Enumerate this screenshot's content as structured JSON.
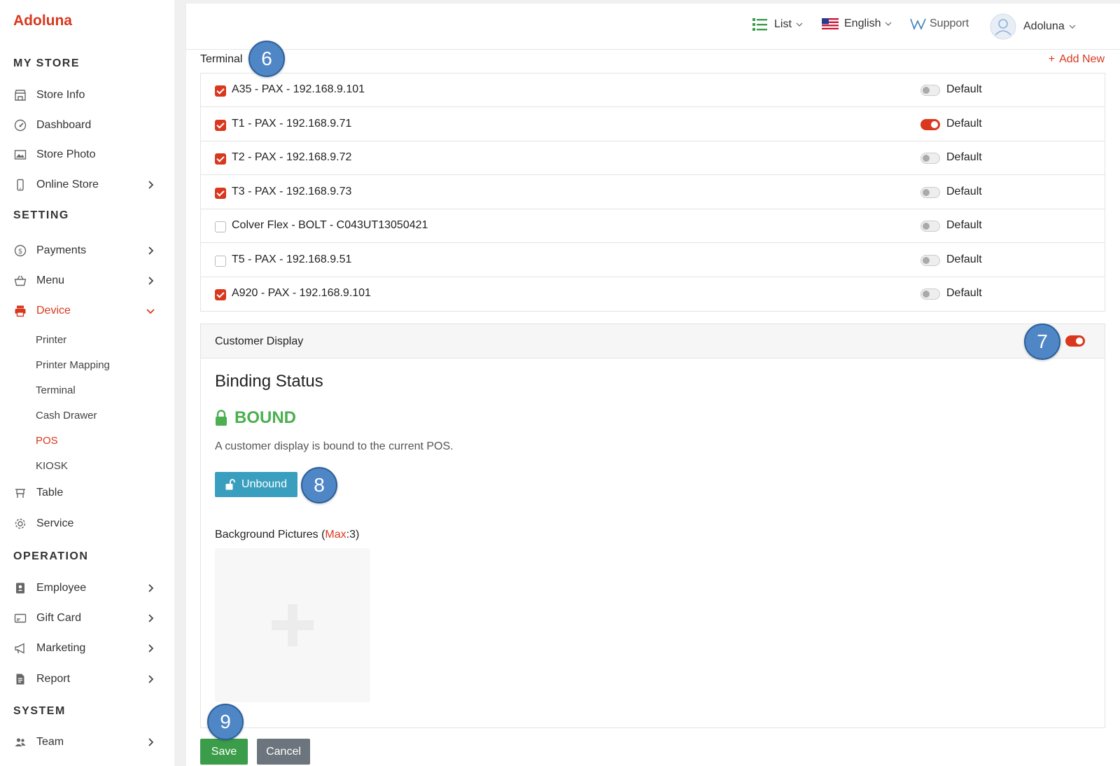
{
  "brand": "Adoluna",
  "sidebar": {
    "sections": {
      "my_store": "MY STORE",
      "setting": "SETTING",
      "operation": "OPERATION",
      "system": "SYSTEM"
    },
    "items": {
      "store_info": "Store Info",
      "dashboard": "Dashboard",
      "store_photo": "Store Photo",
      "online_store": "Online Store",
      "payments": "Payments",
      "menu": "Menu",
      "device": "Device",
      "table": "Table",
      "service": "Service",
      "employee": "Employee",
      "gift_card": "Gift Card",
      "marketing": "Marketing",
      "report": "Report",
      "team": "Team"
    },
    "device_sub": {
      "printer": "Printer",
      "printer_mapping": "Printer Mapping",
      "terminal": "Terminal",
      "cash_drawer": "Cash Drawer",
      "pos": "POS",
      "kiosk": "KIOSK"
    }
  },
  "header": {
    "list": "List",
    "language": "English",
    "support": "Support",
    "user": "Adoluna"
  },
  "terminal": {
    "label": "Terminal",
    "add_new": "Add New",
    "rows": [
      {
        "name": "A35 - PAX - 192.168.9.101",
        "checked": true,
        "default": false,
        "default_label": "Default"
      },
      {
        "name": "T1 - PAX - 192.168.9.71",
        "checked": true,
        "default": true,
        "default_label": "Default"
      },
      {
        "name": "T2 - PAX - 192.168.9.72",
        "checked": true,
        "default": false,
        "default_label": "Default"
      },
      {
        "name": "T3 - PAX - 192.168.9.73",
        "checked": true,
        "default": false,
        "default_label": "Default"
      },
      {
        "name": "Colver Flex - BOLT - C043UT13050421",
        "checked": false,
        "default": false,
        "default_label": "Default"
      },
      {
        "name": "T5 - PAX - 192.168.9.51",
        "checked": false,
        "default": false,
        "default_label": "Default"
      },
      {
        "name": "A920 - PAX - 192.168.9.101",
        "checked": true,
        "default": false,
        "default_label": "Default"
      }
    ]
  },
  "customer_display": {
    "title": "Customer Display",
    "enabled": true,
    "binding_title": "Binding Status",
    "status": "BOUND",
    "description": "A customer display is bound to the current POS.",
    "unbound_button": "Unbound",
    "bg_label_prefix": "Background Pictures (",
    "bg_label_max": "Max",
    "bg_label_suffix": ":3)"
  },
  "actions": {
    "save": "Save",
    "cancel": "Cancel"
  },
  "markers": {
    "m6": "6",
    "m7": "7",
    "m8": "8",
    "m9": "9"
  },
  "colors": {
    "accent": "#d9381e",
    "success": "#4caf50",
    "info": "#3a9fbf",
    "marker": "#4f86c6"
  }
}
